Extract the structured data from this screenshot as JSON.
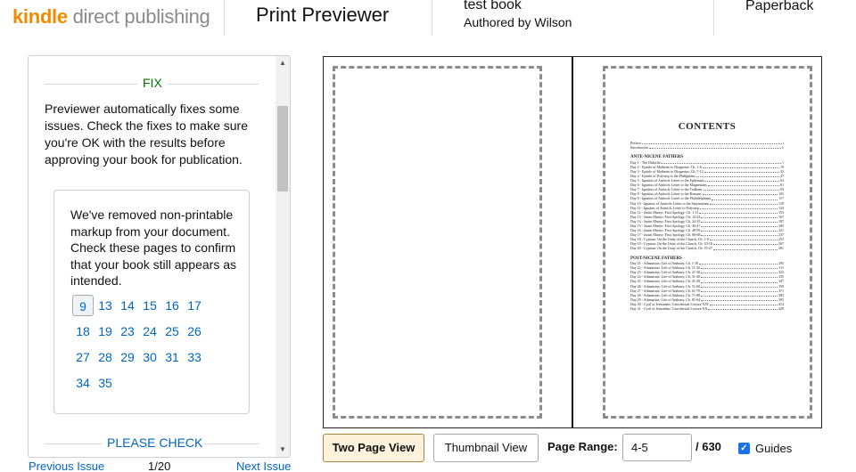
{
  "header": {
    "logo_kindle": "kindle",
    "logo_rest": " direct publishing",
    "app_title": "Print Previewer",
    "book_title": "test book",
    "book_author": "Authored by Wilson",
    "format": "Paperback"
  },
  "panel": {
    "fix_heading": "FIX",
    "fix_text": "Previewer automatically fixes some issues. Check the fixes to make sure you're OK with the results before approving your book for publication.",
    "notice_text": "We've removed non-printable markup from your document. Check these pages to confirm that your book still appears as intended.",
    "pages": [
      "9",
      "13",
      "14",
      "15",
      "16",
      "17",
      "18",
      "19",
      "23",
      "24",
      "25",
      "26",
      "27",
      "28",
      "29",
      "30",
      "31",
      "33",
      "34",
      "35"
    ],
    "active_page": "9",
    "check_heading": "PLEASE CHECK",
    "prev_label": "Previous Issue",
    "count": "1/20",
    "next_label": "Next Issue"
  },
  "preview": {
    "toc_title": "CONTENTS",
    "front_matter": [
      {
        "t": "Preface",
        "p": "i"
      },
      {
        "t": "Introduction",
        "p": "v"
      }
    ],
    "sections": [
      {
        "title": "ANTE-NICENE FATHERS",
        "rows": [
          {
            "t": "Day 1 - The Didache",
            "p": "1"
          },
          {
            "t": "Day 2 - Epistle of Mathetes to Diognetus: Ch. 1-6",
            "p": "19"
          },
          {
            "t": "Day 3 - Epistle of Mathetes to Diognetus: Ch. 7-12",
            "p": "33"
          },
          {
            "t": "Day 4 - Epistle of Polycarp to the Philippians",
            "p": "47"
          },
          {
            "t": "Day 5 - Ignatius of Antioch: Letter to the Ephesians",
            "p": "63"
          },
          {
            "t": "Day 6 - Ignatius of Antioch: Letter to the Magnesians",
            "p": "81"
          },
          {
            "t": "Day 7 - Ignatius of Antioch: Letter to the Trallians",
            "p": "93"
          },
          {
            "t": "Day 8 - Ignatius of Antioch: Letter to the Romans",
            "p": "105"
          },
          {
            "t": "Day 9 - Ignatius of Antioch: Letter to the Philadelphians",
            "p": "117"
          },
          {
            "t": "Day 10 - Ignatius of Antioch: Letter to the Smyrnaeans",
            "p": "129"
          },
          {
            "t": "Day 11 - Ignatius of Antioch: Letter to Polycarp",
            "p": "143"
          },
          {
            "t": "Day 12 - Justin Martyr: First Apology, Ch. 1-11",
            "p": "153"
          },
          {
            "t": "Day 13 - Justin Martyr: First Apology, Ch. 12-23",
            "p": "167"
          },
          {
            "t": "Day 14 - Justin Martyr: First Apology, Ch. 24-35",
            "p": "187"
          },
          {
            "t": "Day 15 - Justin Martyr: First Apology, Ch. 36-47",
            "p": "205"
          },
          {
            "t": "Day 16 - Justin Martyr: First Apology, Ch. 48-59",
            "p": "221"
          },
          {
            "t": "Day 17 - Justin Martyr: First Apology, Ch. 60-68",
            "p": "237"
          },
          {
            "t": "Day 18 - Cyprian: On the Unity of the Church, Ch. 1-9",
            "p": "253"
          },
          {
            "t": "Day 19 - Cyprian: On the Unity of the Church, Ch. 10-18",
            "p": "267"
          },
          {
            "t": "Day 20 - Cyprian: On the Unity of the Church, Ch. 19-27",
            "p": "281"
          }
        ]
      },
      {
        "title": "POST-NICENE FATHERS",
        "rows": [
          {
            "t": "Day 21 - Athanasius: Life of Anthony, Ch. 1-10",
            "p": "293"
          },
          {
            "t": "Day 22 - Athanasius: Life of Anthony, Ch. 11-20",
            "p": "311"
          },
          {
            "t": "Day 23 - Athanasius: Life of Anthony, Ch. 21-30",
            "p": "323"
          },
          {
            "t": "Day 24 - Athanasius: Life of Anthony, Ch. 31-40",
            "p": "335"
          },
          {
            "t": "Day 25 - Athanasius: Life of Anthony, Ch. 41-50",
            "p": "347"
          },
          {
            "t": "Day 26 - Athanasius: Life of Anthony, Ch. 51-60",
            "p": "359"
          },
          {
            "t": "Day 27 - Athanasius: Life of Anthony, Ch. 61-70",
            "p": "371"
          },
          {
            "t": "Day 28 - Athanasius: Life of Anthony, Ch. 71-80",
            "p": "383"
          },
          {
            "t": "Day 29 - Athanasius: Life of Anthony, Ch. 81-94",
            "p": "395"
          },
          {
            "t": "Day 30 - Cyril of Jerusalem: Catechetical Lecture XIX",
            "p": "413"
          },
          {
            "t": "Day 31 - Cyril of Jerusalem: Catechetical Lecture XX",
            "p": "429"
          }
        ]
      }
    ]
  },
  "toolbar": {
    "two_page_label": "Two Page View",
    "thumbnail_label": "Thumbnail View",
    "range_label": "Page Range:",
    "range_value": "4-5",
    "range_total": "/ 630",
    "guides_label": "Guides",
    "guides_checked": true
  },
  "colors": {
    "kindle_orange": "#f08b00",
    "fix_green": "#007600",
    "link_blue": "#0066c0",
    "primary_button_bg": "#fdf3dc",
    "checkbox_blue": "#1a73e8"
  }
}
